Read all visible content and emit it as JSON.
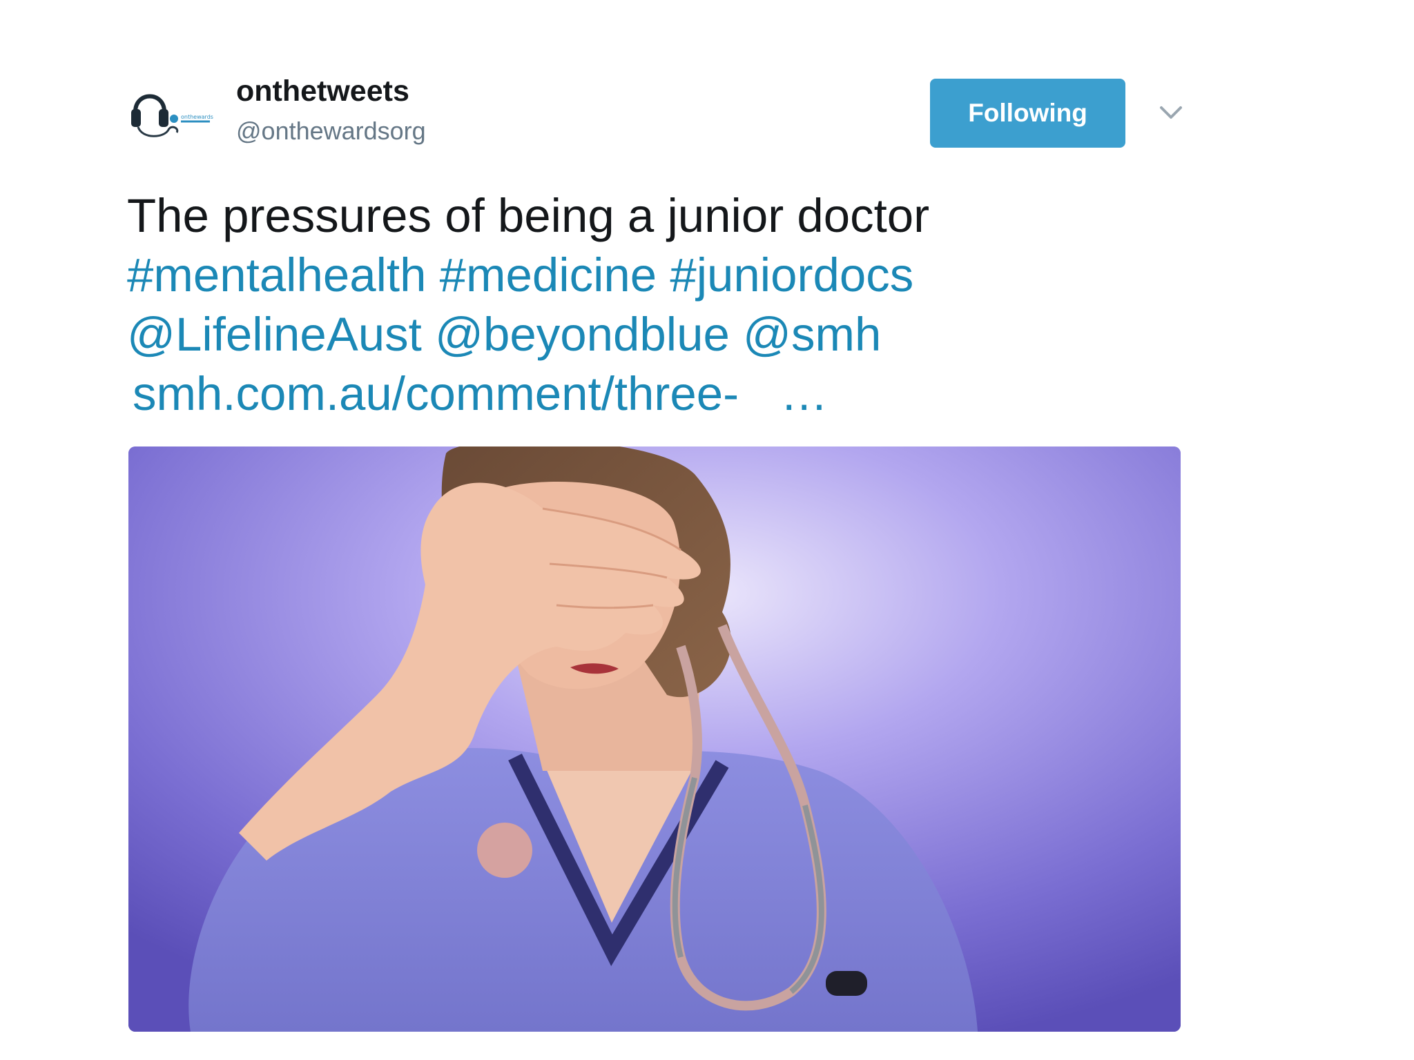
{
  "tweet": {
    "display_name": "onthetweets",
    "handle": "@onthewardsorg",
    "avatar_icon": "headphones-stethoscope-logo",
    "follow_button_label": "Following",
    "menu_icon": "chevron-down-icon",
    "text": "The pressures of being a junior doctor",
    "hashtags": [
      "#mentalhealth",
      "#medicine",
      "#juniordocs"
    ],
    "mentions": [
      "@LifelineAust",
      "@beyondblue",
      "@smh"
    ],
    "link_text": "smh.com.au/comment/three-",
    "ellipsis": "…"
  },
  "colors": {
    "follow_button": "#3c9fcf",
    "link": "#1b88b6",
    "text": "#14171a",
    "secondary_text": "#657786",
    "media_background": "#7f74d4"
  },
  "media": {
    "description_icon": "photo-stressed-doctor"
  }
}
